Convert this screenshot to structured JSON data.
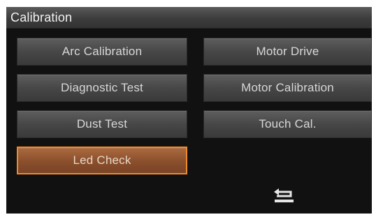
{
  "header": {
    "title": "Calibration"
  },
  "menu": {
    "arc_calibration": "Arc Calibration",
    "motor_drive": "Motor Drive",
    "diagnostic_test": "Diagnostic Test",
    "motor_calibration": "Motor Calibration",
    "dust_test": "Dust Test",
    "touch_cal": "Touch Cal.",
    "led_check": "Led Check"
  },
  "icons": {
    "back": "return-arrow-icon"
  },
  "colors": {
    "selected_border": "#f08a2a",
    "selected_fill": "#8a4f2d",
    "button_fill": "#474747",
    "background": "#111111"
  }
}
